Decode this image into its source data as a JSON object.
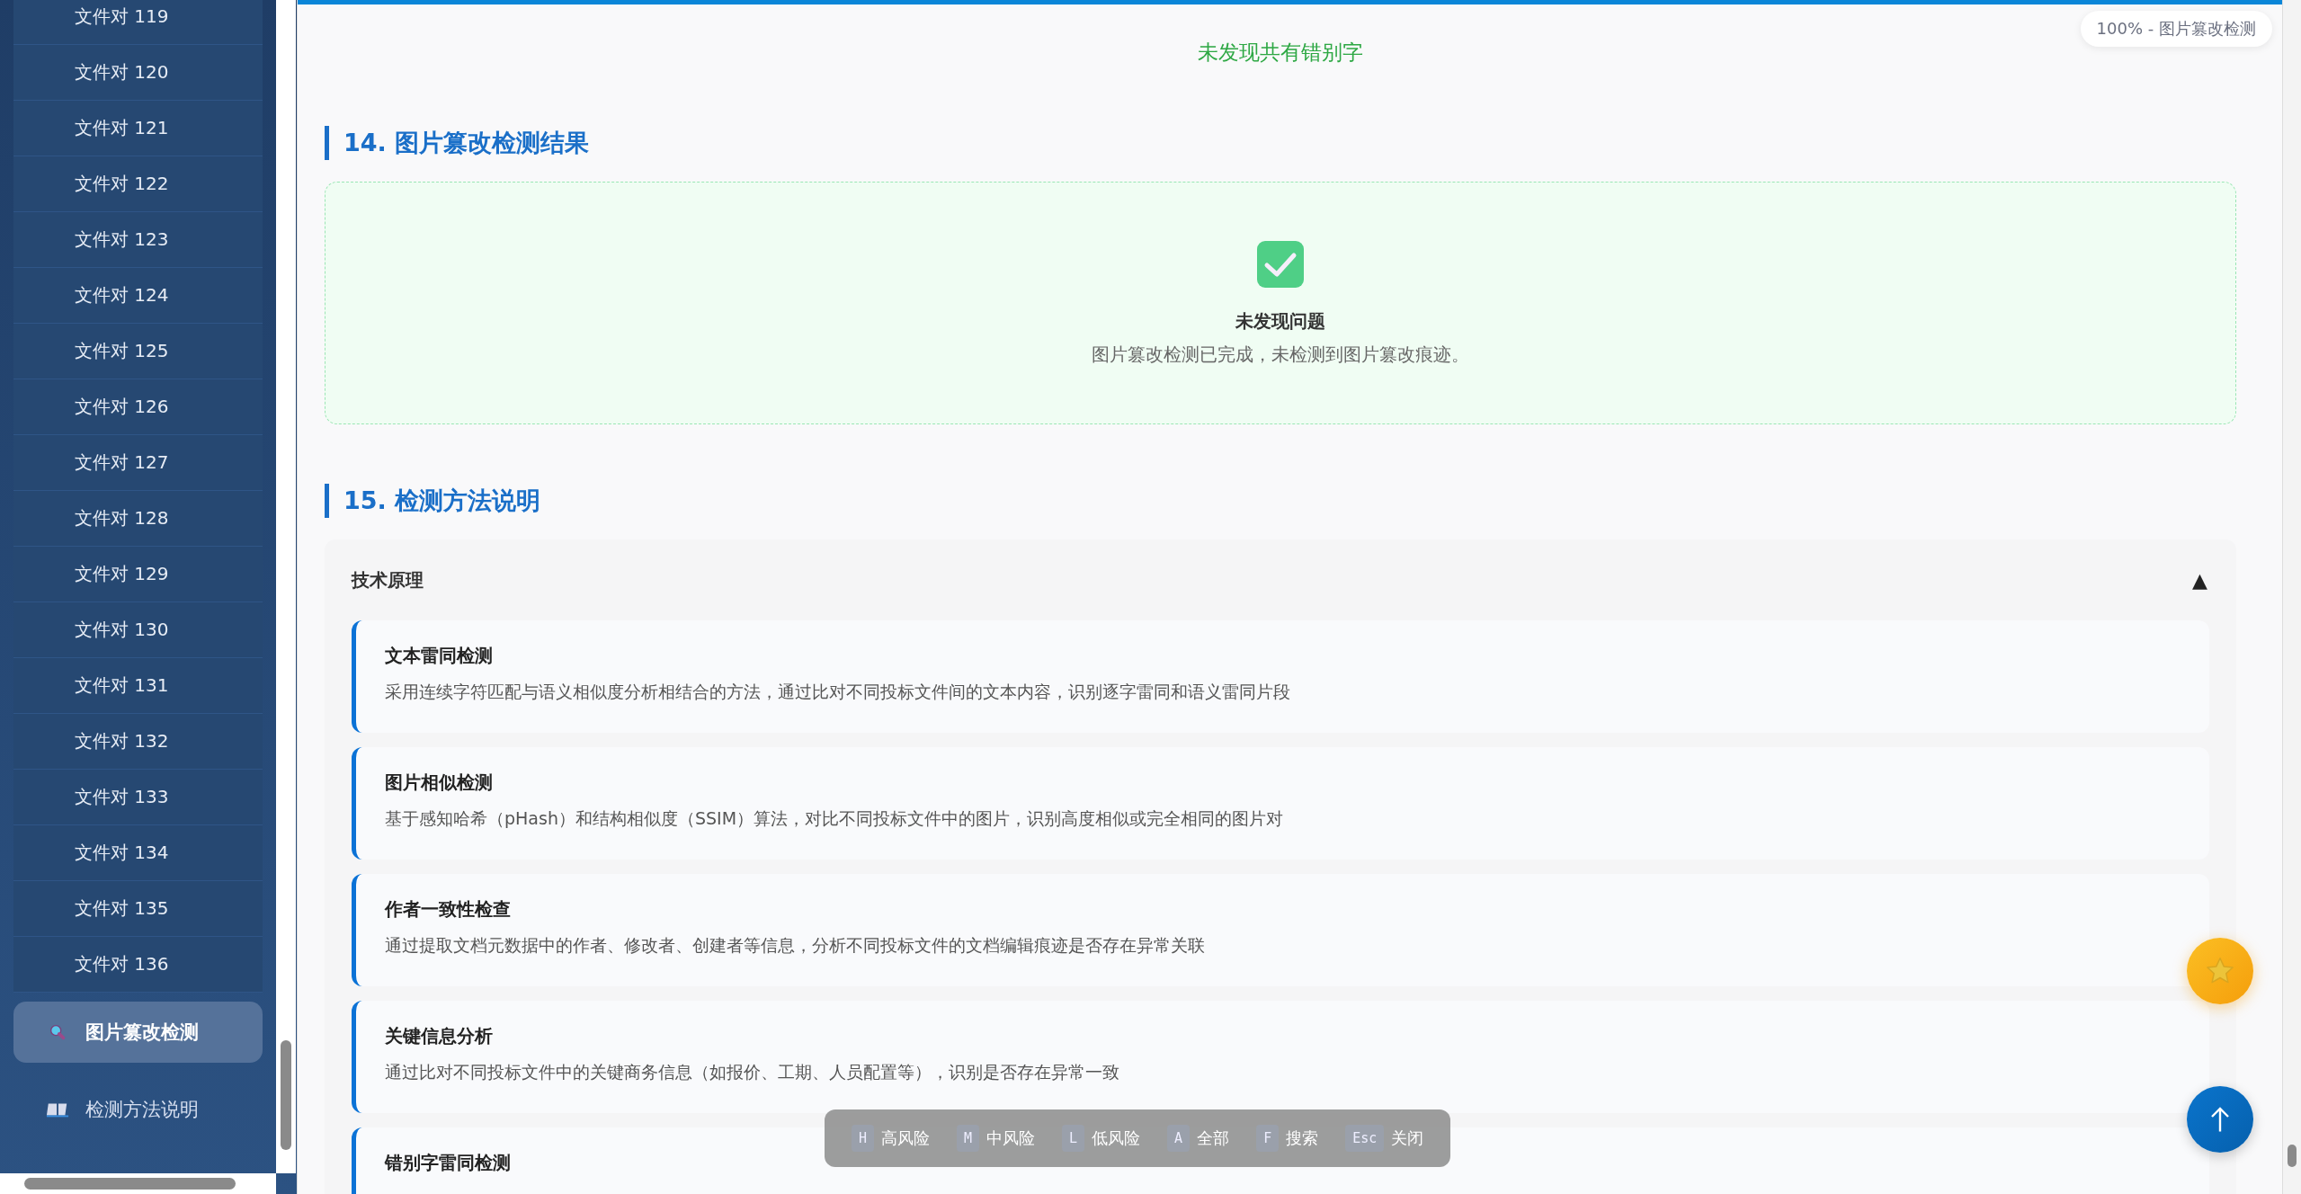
{
  "sidebar": {
    "items": [
      {
        "label": "文件对 119",
        "kind": "doc",
        "selected": false
      },
      {
        "label": "文件对 120",
        "kind": "doc",
        "selected": false
      },
      {
        "label": "文件对 121",
        "kind": "doc",
        "selected": false
      },
      {
        "label": "文件对 122",
        "kind": "doc",
        "selected": false
      },
      {
        "label": "文件对 123",
        "kind": "doc",
        "selected": false
      },
      {
        "label": "文件对 124",
        "kind": "doc",
        "selected": false
      },
      {
        "label": "文件对 125",
        "kind": "doc",
        "selected": false
      },
      {
        "label": "文件对 126",
        "kind": "doc",
        "selected": false
      },
      {
        "label": "文件对 127",
        "kind": "doc",
        "selected": false
      },
      {
        "label": "文件对 128",
        "kind": "doc",
        "selected": false
      },
      {
        "label": "文件对 129",
        "kind": "doc",
        "selected": false
      },
      {
        "label": "文件对 130",
        "kind": "doc",
        "selected": false
      },
      {
        "label": "文件对 131",
        "kind": "doc",
        "selected": false
      },
      {
        "label": "文件对 132",
        "kind": "doc",
        "selected": false
      },
      {
        "label": "文件对 133",
        "kind": "doc",
        "selected": false
      },
      {
        "label": "文件对 134",
        "kind": "doc",
        "selected": false
      },
      {
        "label": "文件对 135",
        "kind": "doc",
        "selected": false
      },
      {
        "label": "文件对 136",
        "kind": "doc",
        "selected": false
      },
      {
        "label": "图片篡改检测",
        "kind": "magnifier",
        "selected": true
      },
      {
        "label": "检测方法说明",
        "kind": "book",
        "selected": false
      }
    ]
  },
  "progress": {
    "level": 1,
    "label": "100% - 图片篡改检测"
  },
  "top_notice": "未发现共有错别字",
  "sections": [
    {
      "kind": "result",
      "title": "14. 图片篡改检测结果",
      "result": {
        "title": "未发现问题",
        "message": "图片篡改检测已完成，未检测到图片篡改痕迹。"
      }
    },
    {
      "kind": "accordion",
      "title": "15. 检测方法说明",
      "accordion": {
        "title": "技术原理",
        "toggle": "▲",
        "expanded": true,
        "items": [
          {
            "title": "文本雷同检测",
            "text": "采用连续字符匹配与语义相似度分析相结合的方法，通过比对不同投标文件间的文本内容，识别逐字雷同和语义雷同片段"
          },
          {
            "title": "图片相似检测",
            "text": "基于感知哈希（pHash）和结构相似度（SSIM）算法，对比不同投标文件中的图片，识别高度相似或完全相同的图片对"
          },
          {
            "title": "作者一致性检查",
            "text": "通过提取文档元数据中的作者、修改者、创建者等信息，分析不同投标文件的文档编辑痕迹是否存在异常关联"
          },
          {
            "title": "关键信息分析",
            "text": "通过比对不同投标文件中的关键商务信息（如报价、工期、人员配置等），识别是否存在异常一致"
          },
          {
            "title": "错别字雷同检测"
          }
        ]
      }
    }
  ],
  "shortcuts": [
    {
      "key": "H",
      "label": "高风险"
    },
    {
      "key": "M",
      "label": "中风险"
    },
    {
      "key": "L",
      "label": "低风险"
    },
    {
      "key": "A",
      "label": "全部"
    },
    {
      "key": "F",
      "label": "搜索"
    },
    {
      "key": "Esc",
      "label": "关闭"
    }
  ]
}
